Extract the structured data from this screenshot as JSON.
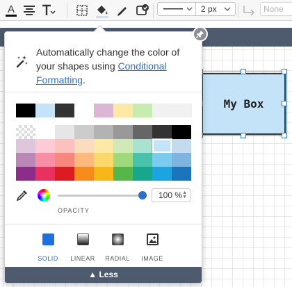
{
  "toolbar": {
    "line_width": "2 px",
    "arrow_style": "None",
    "icons": [
      "text-color-icon",
      "align-icon",
      "text-size-icon",
      "border-icon",
      "fill-color-icon",
      "line-color-icon",
      "format-icon",
      "waypoint-icon"
    ]
  },
  "popover": {
    "tip_text": "Automatically change the color of your shapes using",
    "tip_link": "Conditional Formatting",
    "tip_end": ".",
    "recent_colors": [
      "#000000",
      "#c4e3f8",
      "#333333",
      "#ffffff",
      "#d9b7d5",
      "#fce9a6",
      "#c6ecaf"
    ],
    "palette": [
      [
        "transparent",
        "#ffffff",
        "#e6e6e6",
        "#cccccc",
        "#b3b3b3",
        "#999999",
        "#666666",
        "#333333",
        "#000000"
      ],
      [
        "#dfc6dd",
        "#fdcbd6",
        "#fbc2bd",
        "#fcdcbe",
        "#fce9a6",
        "#cfeab8",
        "#a8e3d2",
        "#c4e3f8",
        "#c2dbef"
      ],
      [
        "#bb87b7",
        "#f88ea5",
        "#f7867f",
        "#fdb97d",
        "#fad86b",
        "#9fd97a",
        "#4ac2ab",
        "#7ccbf1",
        "#7fb4e1"
      ],
      [
        "#8d2c8a",
        "#e8315e",
        "#dd1c22",
        "#f78b1c",
        "#f7b718",
        "#55b649",
        "#18a78c",
        "#1ba3e2",
        "#1a75bc"
      ]
    ],
    "selected_color": "#c4e3f8",
    "opacity_value": "100 %",
    "opacity_fraction": 1.0,
    "opacity_label": "OPACITY",
    "fill_types": [
      {
        "label": "SOLID",
        "active": true
      },
      {
        "label": "LINEAR",
        "active": false
      },
      {
        "label": "RADIAL",
        "active": false
      },
      {
        "label": "IMAGE",
        "active": false
      }
    ],
    "less_label": "Less"
  },
  "canvas": {
    "shape_label": "My Box",
    "shape_fill": "#c4e3f8"
  }
}
